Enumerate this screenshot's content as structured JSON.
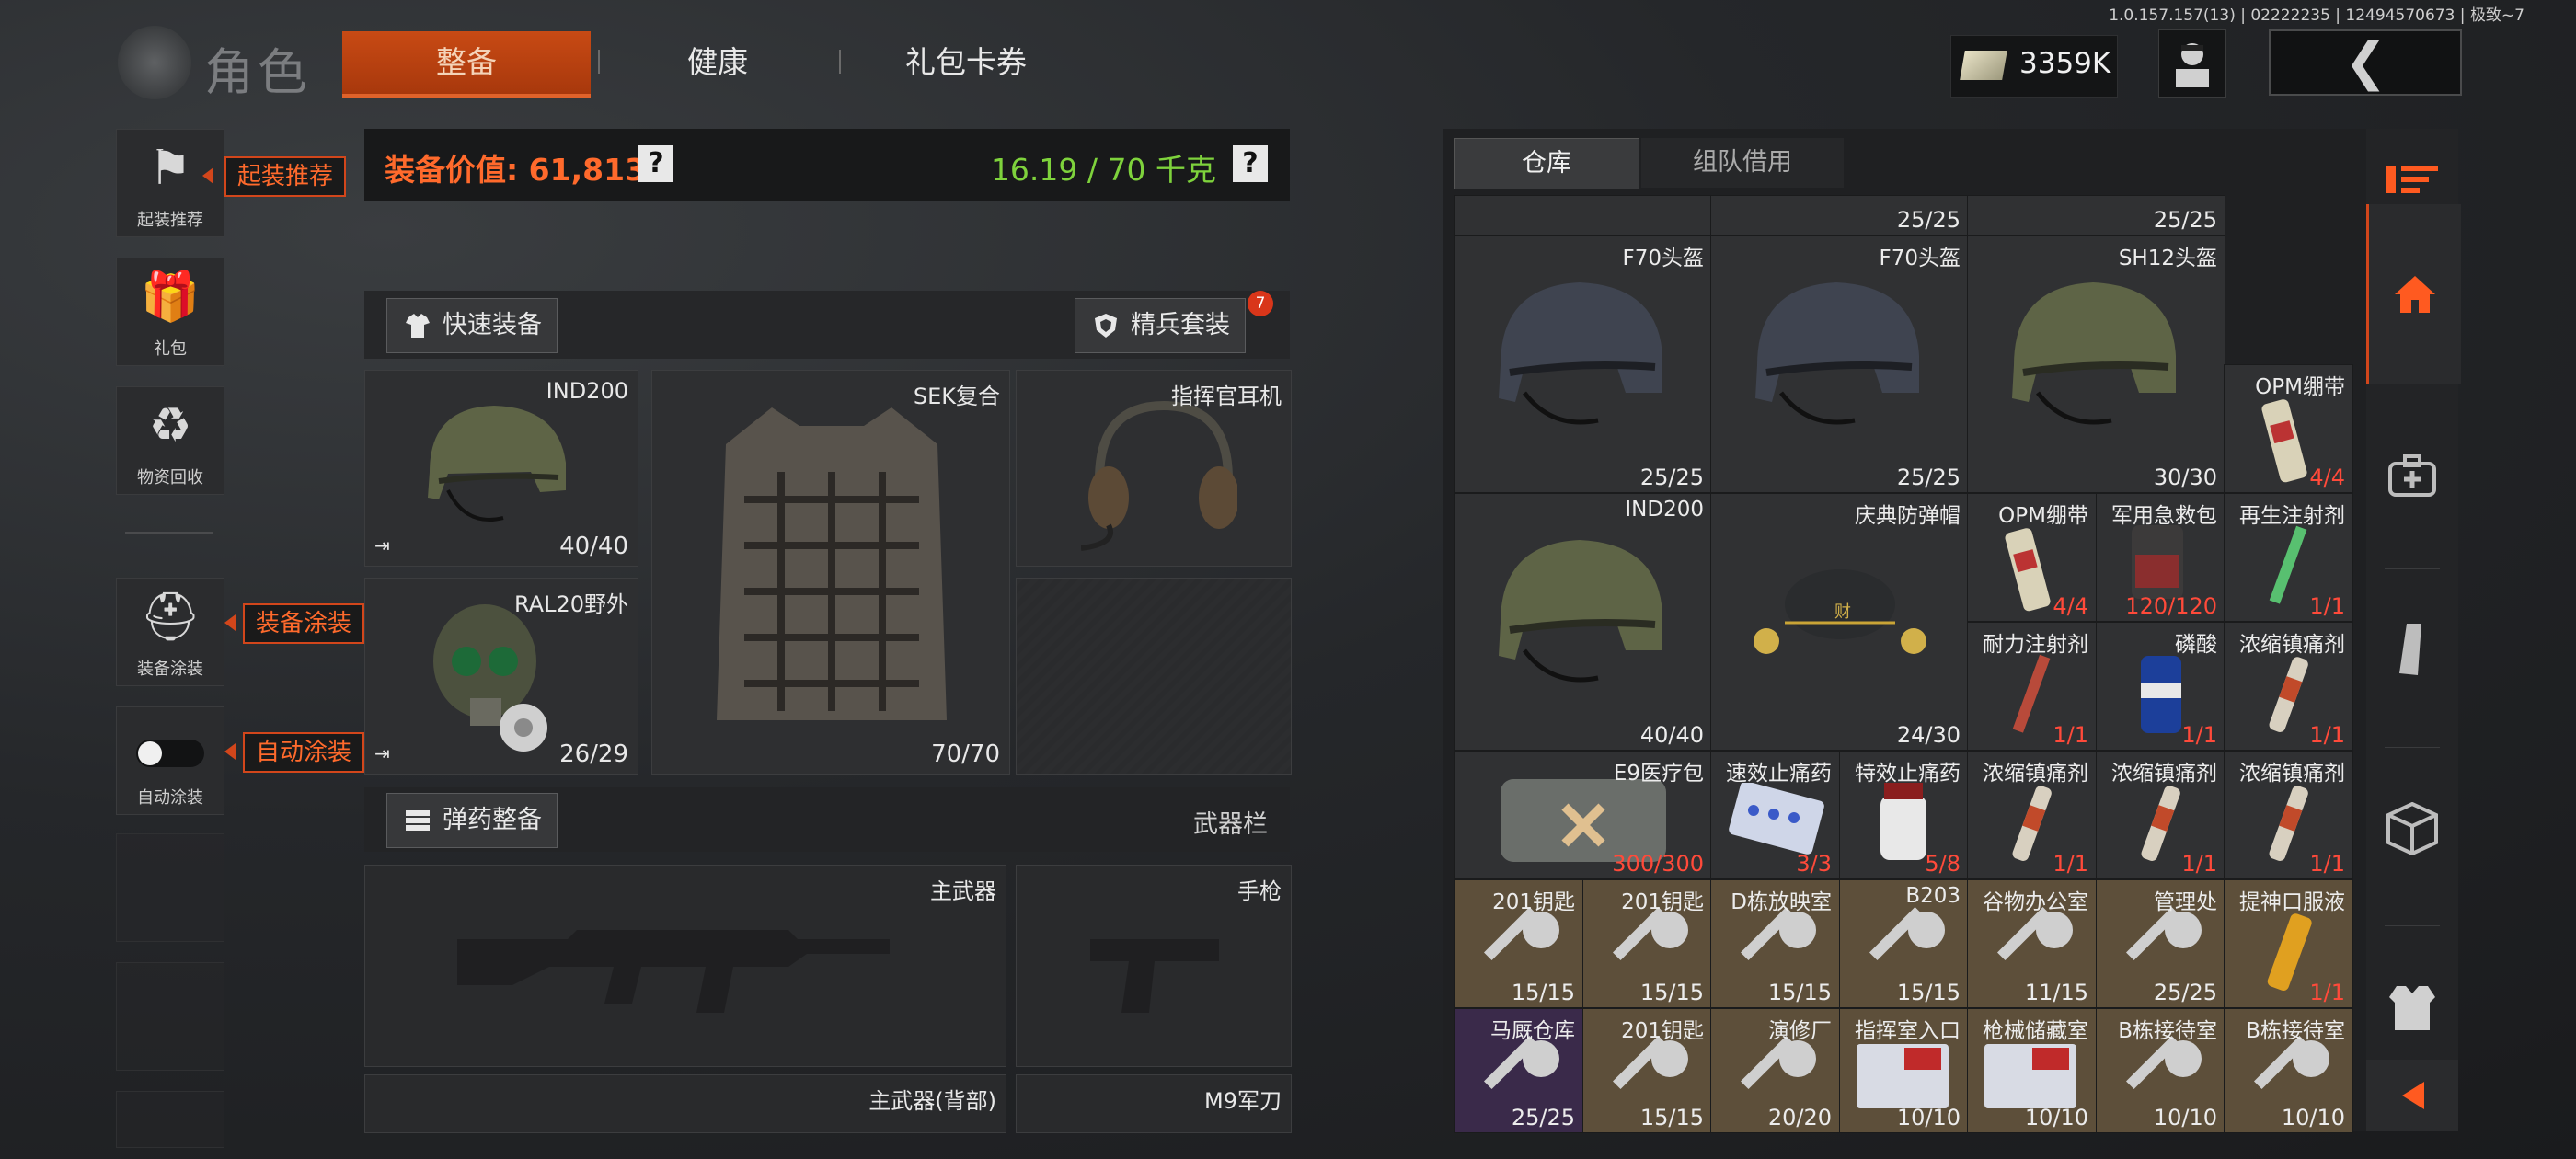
{
  "version": "1.0.157.157(13) | 02222235 | 12494570673 | 极致~7",
  "header": {
    "title": "角色",
    "tabs": [
      {
        "label": "整备",
        "active": true
      },
      {
        "label": "健康",
        "active": false
      },
      {
        "label": "礼包卡券",
        "active": false
      }
    ],
    "money": "3359K",
    "back_icon": "chevron-left-icon"
  },
  "sidebar": {
    "items": [
      {
        "label": "起装推荐",
        "icon": "soldier-helmet-icon",
        "tip": "起装推荐"
      },
      {
        "label": "礼包",
        "icon": "gift-icon"
      },
      {
        "label": "物资回收",
        "icon": "recycle-icon"
      },
      {
        "label": "装备涂装",
        "icon": "paint-helmet-icon",
        "tip": "装备涂装"
      },
      {
        "label": "自动涂装",
        "icon": "toggle-icon",
        "tip": "自动涂装",
        "toggle_on": false
      }
    ]
  },
  "loadout": {
    "value_label": "装备价值: 61,813",
    "weight_label": "16.19 / 70 千克",
    "quick_equip": "快速装备",
    "elite_set": "精兵套装",
    "elite_badge": "7",
    "helmet": {
      "name": "IND200",
      "durability": "40/40"
    },
    "mask": {
      "name": "RAL20野外",
      "durability": "26/29"
    },
    "armor": {
      "name": "SEK复合",
      "durability": "70/70"
    },
    "headset": {
      "name": "指挥官耳机"
    },
    "ammo_prep": "弹药整备",
    "weapon_bar": "武器栏",
    "primary": "主武器",
    "pistol": "手枪",
    "primary_back": "主武器(背部)",
    "melee": "M9军刀"
  },
  "storage": {
    "tabs": [
      {
        "label": "仓库",
        "active": true
      },
      {
        "label": "组队借用",
        "active": false
      }
    ],
    "row0": [
      {
        "name": "",
        "count": ""
      },
      {
        "name": "",
        "count": "25/25"
      },
      {
        "name": "",
        "count": "25/25"
      }
    ],
    "row1": [
      {
        "name": "F70头盔",
        "count": "25/25"
      },
      {
        "name": "F70头盔",
        "count": "25/25"
      },
      {
        "name": "SH12头盔",
        "count": "30/30"
      },
      {
        "name": "OPM绷带",
        "count": "4/4"
      }
    ],
    "row2": [
      {
        "name": "IND200",
        "count": "40/40"
      },
      {
        "name": "庆典防弹帽",
        "count": "24/30"
      },
      {
        "name": "OPM绷带",
        "count": "4/4"
      },
      {
        "name": "军用急救包",
        "count": "120/120"
      },
      {
        "name": "再生注射剂",
        "count": "1/1"
      }
    ],
    "row3": [
      {
        "name": "耐力注射剂",
        "count": "1/1"
      },
      {
        "name": "磷酸",
        "count": "1/1"
      },
      {
        "name": "浓缩镇痛剂",
        "count": "1/1"
      }
    ],
    "row4": [
      {
        "name": "E9医疗包",
        "count": "300/300"
      },
      {
        "name": "速效止痛药",
        "count": "3/3"
      },
      {
        "name": "特效止痛药",
        "count": "5/8"
      },
      {
        "name": "浓缩镇痛剂",
        "count": "1/1"
      },
      {
        "name": "浓缩镇痛剂",
        "count": "1/1"
      },
      {
        "name": "浓缩镇痛剂",
        "count": "1/1"
      }
    ],
    "row5": [
      {
        "name": "201钥匙",
        "count": "15/15"
      },
      {
        "name": "201钥匙",
        "count": "15/15"
      },
      {
        "name": "D栋放映室",
        "count": "15/15"
      },
      {
        "name": "B203",
        "count": "15/15"
      },
      {
        "name": "谷物办公室",
        "count": "11/15"
      },
      {
        "name": "管理处",
        "count": "25/25"
      },
      {
        "name": "提神口服液",
        "count": "1/1"
      }
    ],
    "row6": [
      {
        "name": "马厩仓库",
        "count": "25/25"
      },
      {
        "name": "201钥匙",
        "count": "15/15"
      },
      {
        "name": "演修厂",
        "count": "20/20"
      },
      {
        "name": "指挥室入口",
        "count": "10/10"
      },
      {
        "name": "枪械储藏室",
        "count": "10/10"
      },
      {
        "name": "B栋接待室",
        "count": "10/10"
      },
      {
        "name": "B栋接待室",
        "count": "10/10"
      }
    ]
  },
  "sidenav": {
    "icons": [
      "sort-icon",
      "home-icon",
      "medkit-icon",
      "magazine-icon",
      "box-icon",
      "vest-icon",
      "collapse-arrow-icon"
    ]
  },
  "colors": {
    "accent": "#d2461b",
    "value_orange": "#ff6a2c",
    "weight_green": "#7ed23c"
  }
}
